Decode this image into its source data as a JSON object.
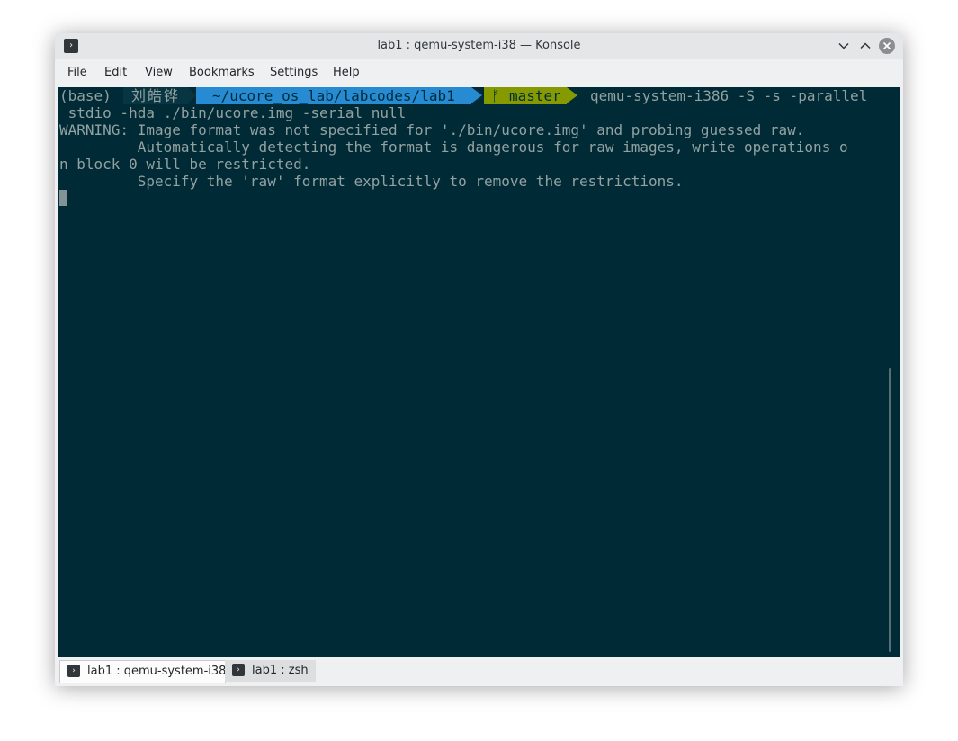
{
  "window": {
    "title": "lab1 : qemu-system-i38 — Konsole",
    "app_icon_glyph": "›"
  },
  "menubar": {
    "items": [
      "File",
      "Edit",
      "View",
      "Bookmarks",
      "Settings",
      "Help"
    ]
  },
  "prompt": {
    "env": "(base)",
    "user": "刘皓铧",
    "dir": "~/ucore_os_lab/labcodes/lab1",
    "branch_glyph": "ᚠ",
    "branch": "master",
    "command_part1": "qemu-system-i386 -S -s -parallel",
    "command_part2": " stdio -hda ./bin/ucore.img -serial null"
  },
  "output": {
    "lines": [
      "WARNING: Image format was not specified for './bin/ucore.img' and probing guessed raw.",
      "         Automatically detecting the format is dangerous for raw images, write operations o",
      "n block 0 will be restricted.",
      "         Specify the 'raw' format explicitly to remove the restrictions."
    ]
  },
  "tabs": [
    {
      "label": "lab1 : qemu-system-i38",
      "active": true,
      "icon_glyph": "›"
    },
    {
      "label": "lab1 : zsh",
      "active": false,
      "icon_glyph": "›"
    }
  ],
  "colors": {
    "terminal_bg": "#002b36",
    "terminal_fg": "#93a1a1",
    "segment_dir": "#268bd2",
    "segment_git": "#859900",
    "segment_user": "#073642"
  }
}
